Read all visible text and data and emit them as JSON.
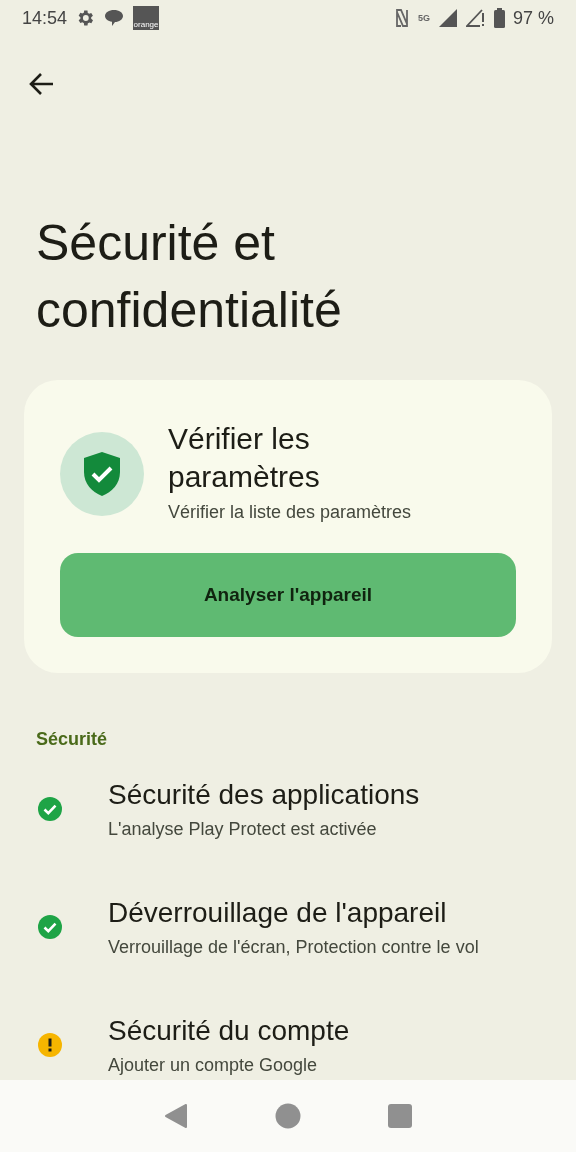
{
  "status_bar": {
    "time": "14:54",
    "carrier_logo": "orange",
    "network": "5G",
    "battery": "97 %"
  },
  "title": "Sécurité et confidentialité",
  "check_card": {
    "title": "Vérifier les paramètres",
    "subtitle": "Vérifier la liste des paramètres",
    "button": "Analyser l'appareil"
  },
  "section": "Sécurité",
  "items": [
    {
      "title": "Sécurité des applications",
      "subtitle": "L'analyse Play Protect est activée",
      "kind": "ok"
    },
    {
      "title": "Déverrouillage de l'appareil",
      "subtitle": "Verrouillage de l'écran, Protection contre le vol",
      "kind": "ok"
    },
    {
      "title": "Sécurité du compte",
      "subtitle": "Ajouter un compte Google",
      "kind": "warning"
    }
  ]
}
